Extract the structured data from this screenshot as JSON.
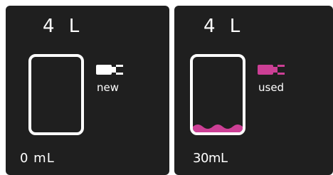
{
  "accent_color": "#cc3f95",
  "panels": [
    {
      "capacity": "4 L",
      "status": "new",
      "volume": "0 mL",
      "plug_color": "#ffffff",
      "fill_fraction": 0
    },
    {
      "capacity": "4 L",
      "status": "used",
      "volume": "30mL",
      "plug_color": "#cc3f95",
      "fill_fraction": 0.05
    }
  ]
}
